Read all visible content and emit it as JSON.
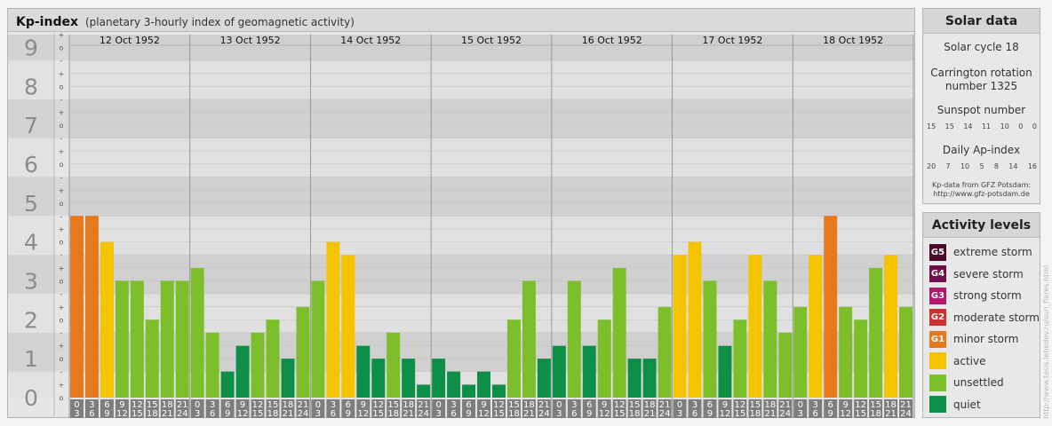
{
  "header": {
    "title": "Kp-index",
    "subtitle": "(planetary 3-hourly index of geomagnetic activity)"
  },
  "chart_data": {
    "type": "bar",
    "days": [
      "12 Oct 1952",
      "13 Oct 1952",
      "14 Oct 1952",
      "15 Oct 1952",
      "16 Oct 1952",
      "17 Oct 1952",
      "18 Oct 1952"
    ],
    "hour_ranges": [
      [
        "0",
        "3"
      ],
      [
        "3",
        "6"
      ],
      [
        "6",
        "9"
      ],
      [
        "9",
        "12"
      ],
      [
        "12",
        "15"
      ],
      [
        "15",
        "18"
      ],
      [
        "18",
        "21"
      ],
      [
        "21",
        "24"
      ]
    ],
    "y_ticks": [
      "0",
      "1",
      "2",
      "3",
      "4",
      "5",
      "6",
      "7",
      "8",
      "9"
    ],
    "y_subticks": [
      "+",
      "o",
      "-"
    ],
    "ylim": [
      0,
      9.33
    ],
    "values": [
      [
        4.67,
        4.67,
        4.0,
        3.0,
        3.0,
        2.0,
        3.0,
        3.0
      ],
      [
        3.33,
        1.67,
        0.67,
        1.33,
        1.67,
        2.0,
        1.0,
        2.33
      ],
      [
        3.0,
        4.0,
        3.67,
        1.33,
        1.0,
        1.67,
        1.0,
        0.33
      ],
      [
        1.0,
        0.67,
        0.33,
        0.67,
        0.33,
        2.0,
        3.0,
        1.0
      ],
      [
        1.33,
        3.0,
        1.33,
        2.0,
        3.33,
        1.0,
        1.0,
        2.33
      ],
      [
        3.67,
        4.0,
        3.0,
        1.33,
        2.0,
        3.67,
        3.0,
        1.67
      ],
      [
        2.33,
        3.67,
        4.67,
        2.33,
        2.0,
        3.33,
        3.67,
        2.33
      ]
    ],
    "level_colors": {
      "quiet": "#0e8f47",
      "unsettled": "#7cbf2a",
      "active": "#f5c400",
      "minor_storm": "#e6781e",
      "moderate_storm": "#c9322d",
      "strong_storm": "#b0196c",
      "severe_storm": "#6f0f4a",
      "extreme_storm": "#4a0a2a"
    },
    "grid": true,
    "legend": "right"
  },
  "solar_data": {
    "title": "Solar data",
    "cycle_text": "Solar cycle 18",
    "carrington_line1": "Carrington rotation",
    "carrington_line2": "number 1325",
    "sunspot_title": "Sunspot number",
    "sunspot_values": [
      "15",
      "15",
      "14",
      "11",
      "10",
      "0",
      "0"
    ],
    "ap_title": "Daily Ap-index",
    "ap_values": [
      "20",
      "7",
      "10",
      "5",
      "8",
      "14",
      "16"
    ],
    "source_line1": "Kp-data from GFZ Potsdam:",
    "source_line2": "http://www.gfz-potsdam.de"
  },
  "activity_levels": {
    "title": "Activity levels",
    "items": [
      {
        "badge": "G5",
        "label": "extreme storm",
        "color": "#4a0a2a"
      },
      {
        "badge": "G4",
        "label": "severe storm",
        "color": "#6f0f4a"
      },
      {
        "badge": "G3",
        "label": "strong storm",
        "color": "#b0196c"
      },
      {
        "badge": "G2",
        "label": "moderate storm",
        "color": "#c9322d"
      },
      {
        "badge": "G1",
        "label": "minor storm",
        "color": "#e6781e"
      },
      {
        "badge": "",
        "label": "active",
        "color": "#f5c400"
      },
      {
        "badge": "",
        "label": "unsettled",
        "color": "#7cbf2a"
      },
      {
        "badge": "",
        "label": "quiet",
        "color": "#0e8f47"
      }
    ]
  },
  "credit": "http://www.tesis.lebedev.ru/sun_flares.html"
}
